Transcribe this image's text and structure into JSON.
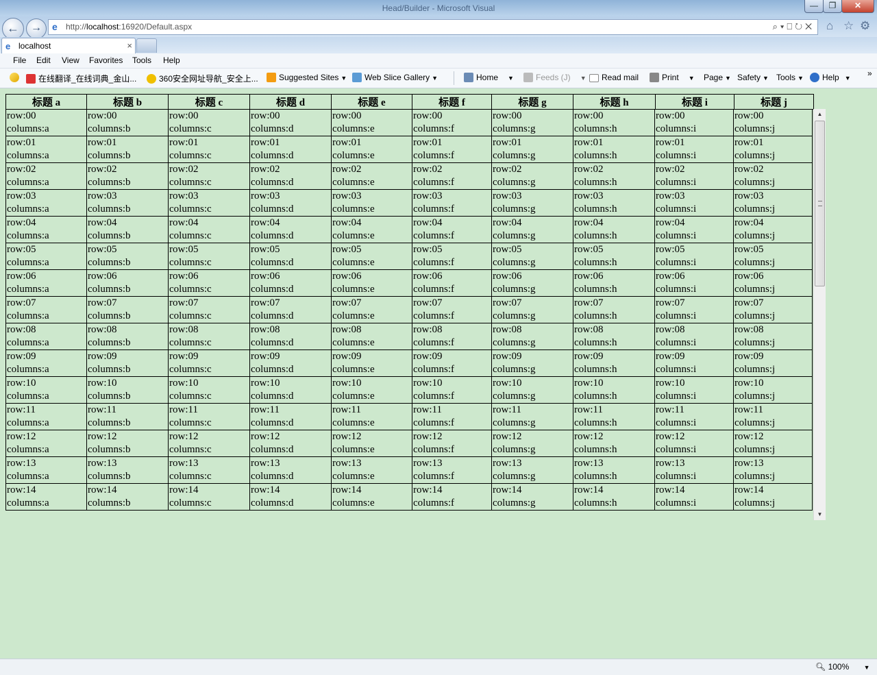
{
  "window": {
    "title": "Head/Builder - Microsoft Visual",
    "min_label": "—",
    "max_label": "❐",
    "close_label": "✕"
  },
  "address": {
    "url_prefix": "http://",
    "url_host": "localhost",
    "url_rest": ":16920/Default.aspx",
    "tools": "⌕▾⎕↻✕"
  },
  "tab": {
    "label": "localhost",
    "close": "×"
  },
  "menu": [
    "File",
    "Edit",
    "View",
    "Favorites",
    "Tools",
    "Help"
  ],
  "favorites": [
    {
      "label": "在线翻译_在线词典_金山...",
      "icon": "dictionary-icon"
    },
    {
      "label": "360安全网址导航_安全上...",
      "icon": "360-icon"
    },
    {
      "label": "Suggested Sites",
      "icon": "suggested-sites-icon"
    },
    {
      "label": "Web Slice Gallery",
      "icon": "web-slice-icon"
    }
  ],
  "commands": {
    "home": "Home",
    "feeds": "Feeds (J)",
    "read_mail": "Read mail",
    "print": "Print",
    "page": "Page",
    "safety": "Safety",
    "tools": "Tools",
    "help": "Help"
  },
  "table": {
    "headers": [
      "标题 a",
      "标题 b",
      "标题 c",
      "标题 d",
      "标题 e",
      "标题 f",
      "标题 g",
      "标题 h",
      "标题 i",
      "标题 j"
    ],
    "column_letters": [
      "a",
      "b",
      "c",
      "d",
      "e",
      "f",
      "g",
      "h",
      "i",
      "j"
    ],
    "row_ids": [
      "00",
      "01",
      "02",
      "03",
      "04",
      "05",
      "06",
      "07",
      "08",
      "09",
      "10",
      "11",
      "12",
      "13",
      "14"
    ],
    "row_prefix": "row:",
    "column_prefix": "columns:"
  },
  "status": {
    "zoom": "100%"
  },
  "colors": {
    "page_bg": "#cde8cd",
    "border": "#000000"
  }
}
